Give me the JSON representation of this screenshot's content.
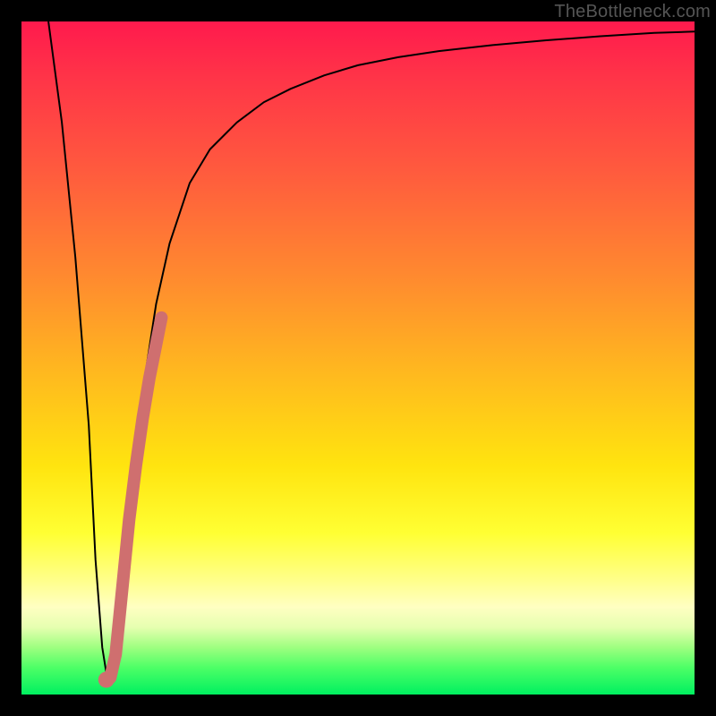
{
  "watermark": "TheBottleneck.com",
  "chart_data": {
    "type": "line",
    "title": "",
    "xlabel": "",
    "ylabel": "",
    "xlim": [
      0,
      100
    ],
    "ylim": [
      0,
      100
    ],
    "gradient_stops": [
      {
        "pos": 0,
        "color": "#ff1a4d"
      },
      {
        "pos": 8,
        "color": "#ff3348"
      },
      {
        "pos": 22,
        "color": "#ff5a3e"
      },
      {
        "pos": 38,
        "color": "#ff8a2f"
      },
      {
        "pos": 52,
        "color": "#ffb81f"
      },
      {
        "pos": 66,
        "color": "#ffe40f"
      },
      {
        "pos": 76,
        "color": "#ffff33"
      },
      {
        "pos": 83,
        "color": "#ffff8a"
      },
      {
        "pos": 87,
        "color": "#ffffc2"
      },
      {
        "pos": 90,
        "color": "#e6ffb0"
      },
      {
        "pos": 93,
        "color": "#9eff80"
      },
      {
        "pos": 96,
        "color": "#4dff66"
      },
      {
        "pos": 100,
        "color": "#00f060"
      }
    ],
    "series": [
      {
        "name": "black-curve",
        "stroke": "#000000",
        "width": 2,
        "x": [
          4,
          6,
          8,
          10,
          11,
          12,
          12.8,
          14,
          16,
          18,
          20,
          22,
          25,
          28,
          32,
          36,
          40,
          45,
          50,
          56,
          62,
          70,
          78,
          86,
          94,
          100
        ],
        "y": [
          100,
          85,
          65,
          40,
          20,
          7,
          2,
          5,
          25,
          45,
          58,
          67,
          76,
          81,
          85,
          88,
          90,
          92,
          93.5,
          94.7,
          95.6,
          96.5,
          97.2,
          97.8,
          98.3,
          98.5
        ]
      },
      {
        "name": "pink-stroke",
        "stroke": "#cf6f6f",
        "width": 14,
        "linecap": "round",
        "x": [
          13.2,
          14,
          15,
          16,
          17,
          18,
          19,
          20,
          20.8
        ],
        "y": [
          2.5,
          6,
          16,
          26,
          34,
          41,
          47,
          52,
          56
        ]
      },
      {
        "name": "pink-dot",
        "stroke": "#cf6f6f",
        "type": "point",
        "r": 9,
        "x": [
          12.6
        ],
        "y": [
          2.2
        ]
      }
    ]
  }
}
